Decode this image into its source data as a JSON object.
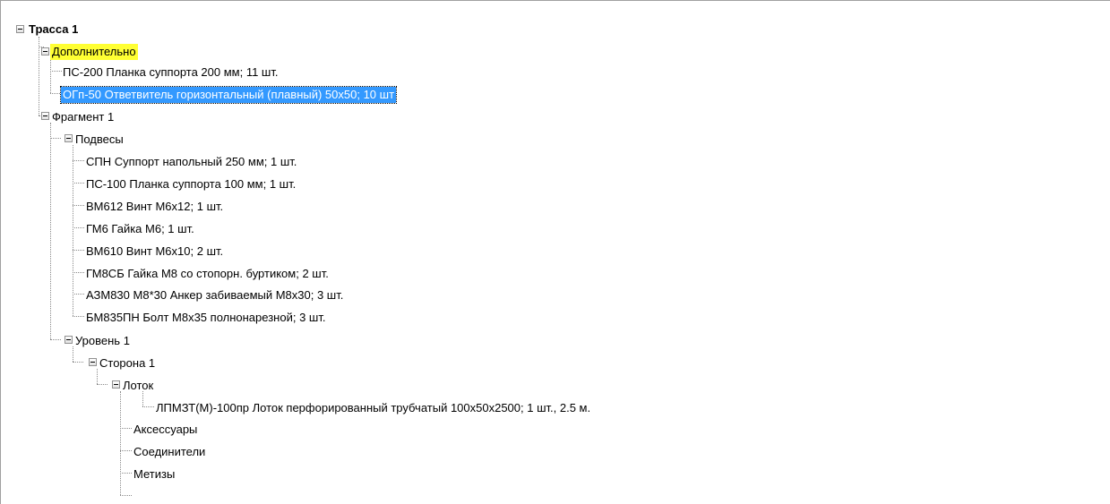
{
  "tree": {
    "root": "Трасса 1",
    "dop": {
      "label": "Дополнительно",
      "items": [
        "ПС-200  Планка суппорта 200 мм;  11 шт.",
        "ОГп-50  Ответвитель горизонтальный (плавный) 50х50;  10 шт"
      ]
    },
    "fragment": {
      "label": "Фрагмент 1",
      "podvesy": {
        "label": "Подвесы",
        "items": [
          "СПН  Суппорт напольный 250 мм;  1 шт.",
          "ПС-100  Планка суппорта 100 мм;  1 шт.",
          "ВМ612  Винт М6х12;  1 шт.",
          "ГМ6  Гайка М6;  1 шт.",
          "ВМ610  Винт М6х10;  2 шт.",
          "ГМ8СБ  Гайка М8 со стопорн. буртиком;  2 шт.",
          "АЗМ830 М8*30  Анкер забиваемый М8х30;  3 шт.",
          "БМ835ПН  Болт М8х35 полнонарезной;  3 шт."
        ]
      },
      "level": {
        "label": "Уровень 1",
        "side": {
          "label": "Сторона 1",
          "tray": {
            "label": "Лоток",
            "items": [
              "ЛПМЗТ(М)-100пр  Лоток перфорированный трубчатый 100х50х2500;  1 шт., 2.5 м."
            ]
          },
          "items": [
            "Аксессуары",
            "Соединители",
            "Метизы"
          ]
        }
      }
    }
  }
}
